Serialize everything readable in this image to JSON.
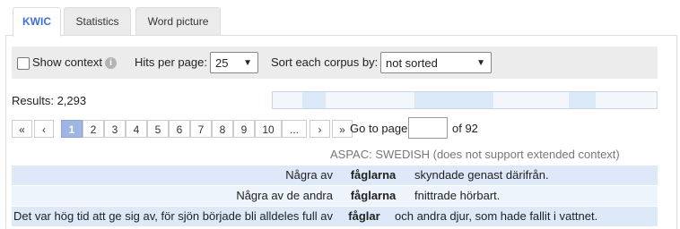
{
  "tabs": [
    {
      "label": "KWIC",
      "active": true
    },
    {
      "label": "Statistics",
      "active": false
    },
    {
      "label": "Word picture",
      "active": false
    }
  ],
  "controls": {
    "show_context_label": "Show context",
    "show_context_checked": false,
    "info_icon": "i",
    "hits_label": "Hits per page:",
    "hits_value": "25",
    "sort_label": "Sort each corpus by:",
    "sort_value": "not sorted"
  },
  "results_label": "Results: 2,293",
  "pagination": {
    "first": "«",
    "prev": "‹",
    "pages": [
      "1",
      "2",
      "3",
      "4",
      "5",
      "6",
      "7",
      "8",
      "9",
      "10",
      "..."
    ],
    "current": "1",
    "next": "›",
    "last": "»",
    "goto_label": "Go to page",
    "goto_value": "",
    "of_label": "of 92"
  },
  "corpus_heading": "ASPAC: SWEDISH (does not support extended context)",
  "kwic_rows": [
    {
      "left": "Några av",
      "keyword": "fåglarna",
      "right": "skyndade genast därifrån."
    },
    {
      "left": "Några av de andra",
      "keyword": "fåglarna",
      "right": "fnittrade hörbart."
    },
    {
      "left": "Det var hög tid att ge sig av, för sjön började bli alldeles full av",
      "keyword": "fåglar",
      "right": "och andra djur, som hade fallit i vattnet."
    }
  ],
  "colors": {
    "accent": "#3f6fd8",
    "row_highlight": "#dde9f8",
    "active_page": "#9fb6e3"
  }
}
